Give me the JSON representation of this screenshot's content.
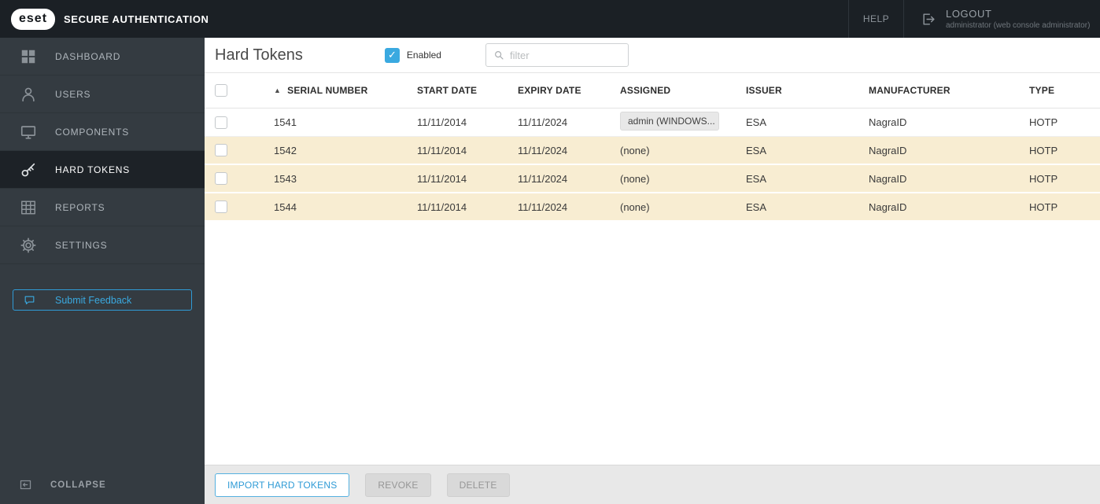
{
  "topbar": {
    "logo_text": "eset",
    "app_title": "SECURE AUTHENTICATION",
    "help_label": "HELP",
    "logout_label": "LOGOUT",
    "logout_subtitle": "administrator (web console administrator)"
  },
  "sidebar": {
    "items": [
      {
        "label": "DASHBOARD"
      },
      {
        "label": "USERS"
      },
      {
        "label": "COMPONENTS"
      },
      {
        "label": "HARD TOKENS"
      },
      {
        "label": "REPORTS"
      },
      {
        "label": "SETTINGS"
      }
    ],
    "active_item": "HARD TOKENS",
    "feedback_label": "Submit Feedback",
    "collapse_label": "COLLAPSE"
  },
  "main": {
    "title": "Hard Tokens",
    "enabled_checkbox": {
      "label": "Enabled",
      "checked": true
    },
    "filter_placeholder": "filter",
    "table": {
      "columns": [
        "SERIAL NUMBER",
        "START DATE",
        "EXPIRY DATE",
        "ASSIGNED",
        "ISSUER",
        "MANUFACTURER",
        "TYPE"
      ],
      "sort_column": "SERIAL NUMBER",
      "sort_direction": "ascending",
      "rows": [
        {
          "serial": "1541",
          "start_date": "11/11/2014",
          "expiry_date": "11/11/2024",
          "assigned": "admin (WINDOWS...",
          "issuer": "ESA",
          "manufacturer": "NagraID",
          "type": "HOTP"
        },
        {
          "serial": "1542",
          "start_date": "11/11/2014",
          "expiry_date": "11/11/2024",
          "assigned": "(none)",
          "issuer": "ESA",
          "manufacturer": "NagraID",
          "type": "HOTP"
        },
        {
          "serial": "1543",
          "start_date": "11/11/2014",
          "expiry_date": "11/11/2024",
          "assigned": "(none)",
          "issuer": "ESA",
          "manufacturer": "NagraID",
          "type": "HOTP"
        },
        {
          "serial": "1544",
          "start_date": "11/11/2014",
          "expiry_date": "11/11/2024",
          "assigned": "(none)",
          "issuer": "ESA",
          "manufacturer": "NagraID",
          "type": "HOTP"
        }
      ]
    },
    "actions": {
      "import_label": "IMPORT HARD TOKENS",
      "revoke_label": "REVOKE",
      "delete_label": "DELETE"
    }
  },
  "icons": {
    "check": "✓",
    "sort_asc": "▲"
  },
  "colors": {
    "accent_blue": "#3aa9e0",
    "topbar_bg": "#1b2025",
    "sidebar_bg": "#343b41",
    "sidebar_active_bg": "#1d2227",
    "row_highlight": "#f8edd2",
    "actionbar_bg": "#e8e8e8"
  }
}
